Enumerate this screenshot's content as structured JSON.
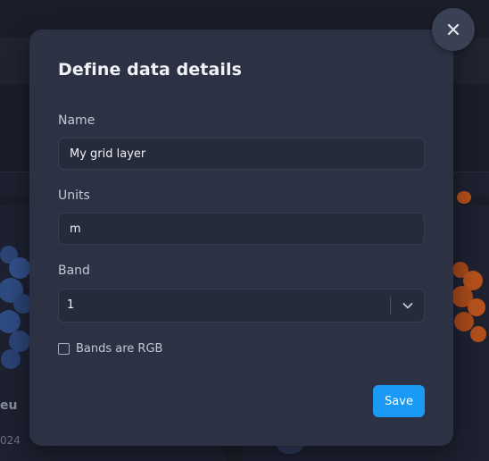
{
  "dialog": {
    "title": "Define data details",
    "fields": {
      "name": {
        "label": "Name",
        "value": "My grid layer"
      },
      "units": {
        "label": "Units",
        "value": "m"
      },
      "band": {
        "label": "Band",
        "value": "1"
      }
    },
    "checkbox": {
      "label": "Bands are RGB",
      "checked": false
    },
    "save_label": "Save",
    "close_icon": "close-icon",
    "chevron_icon": "chevron-down-icon"
  },
  "background": {
    "text_fragment_1": "eu",
    "text_fragment_2": "024"
  },
  "colors": {
    "accent": "#1a9af5",
    "modal_bg": "#2c3143",
    "page_bg": "#1b1e29"
  }
}
